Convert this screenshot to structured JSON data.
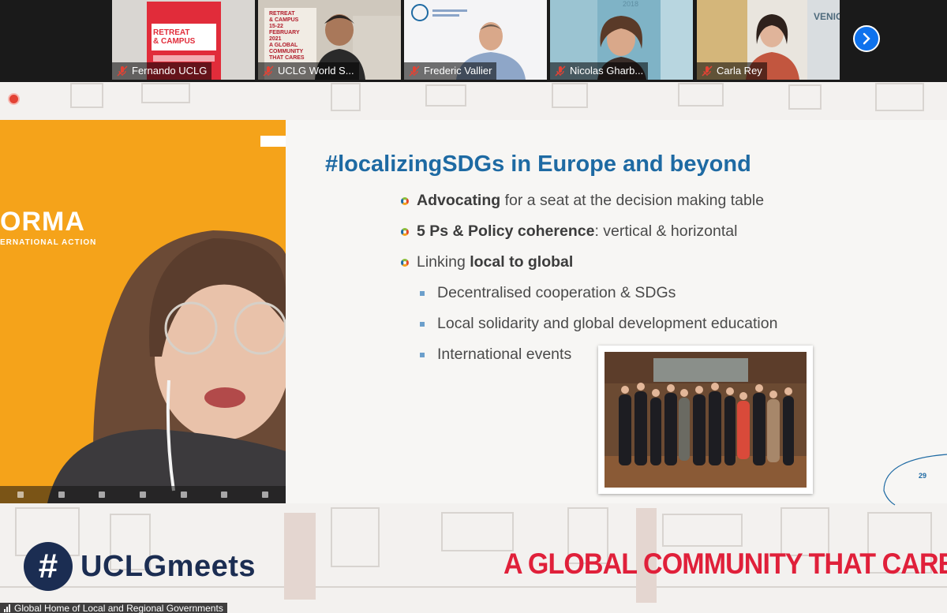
{
  "participants": [
    {
      "name": "Fernando UCLG",
      "poster_lines": [
        "RETREAT",
        "& CAMPUS"
      ]
    },
    {
      "name": "UCLG World S...",
      "poster_lines": [
        "RETREAT",
        "& CAMPUS",
        "15-22",
        "FEBRUARY",
        "2021",
        "A GLOBAL COMMUNITY THAT CARES"
      ]
    },
    {
      "name": "Frederic Vallier"
    },
    {
      "name": "Nicolas Gharb...",
      "poster_lines": [
        "2018"
      ]
    },
    {
      "name": "Carla Rey",
      "poster_lines": [
        "VENIC"
      ]
    }
  ],
  "speaker": {
    "org_logo": "ORMA",
    "org_subtitle": "ERNATIONAL ACTION"
  },
  "slide": {
    "title": "#localizingSDGs in Europe and beyond",
    "bullets": [
      {
        "bold": "Advocating",
        "rest": " for a seat at the decision making table"
      },
      {
        "bold": "5 Ps & Policy coherence",
        "rest": ": vertical & horizontal"
      },
      {
        "pre": "Linking ",
        "bold": "local to global"
      }
    ],
    "sub_bullets": [
      "Decentralised cooperation & SDGs",
      "Local solidarity and global development education",
      "International events"
    ],
    "page_number": "29"
  },
  "branding": {
    "hash": "#",
    "name": "UCLGmeets",
    "tagline": "A GLOBAL COMMUNITY THAT CARES"
  },
  "footer": {
    "text": "Global Home of Local and Regional Governments"
  },
  "colors": {
    "title_blue": "#1e6aa3",
    "tagline_red": "#e0203a",
    "speaker_bg": "#f5a31a",
    "navy": "#1b2d52",
    "zoom_blue": "#0e72ed"
  },
  "icons": [
    "muted-mic-icon",
    "chevron-right-icon",
    "recording-icon",
    "signal-bars-icon"
  ]
}
